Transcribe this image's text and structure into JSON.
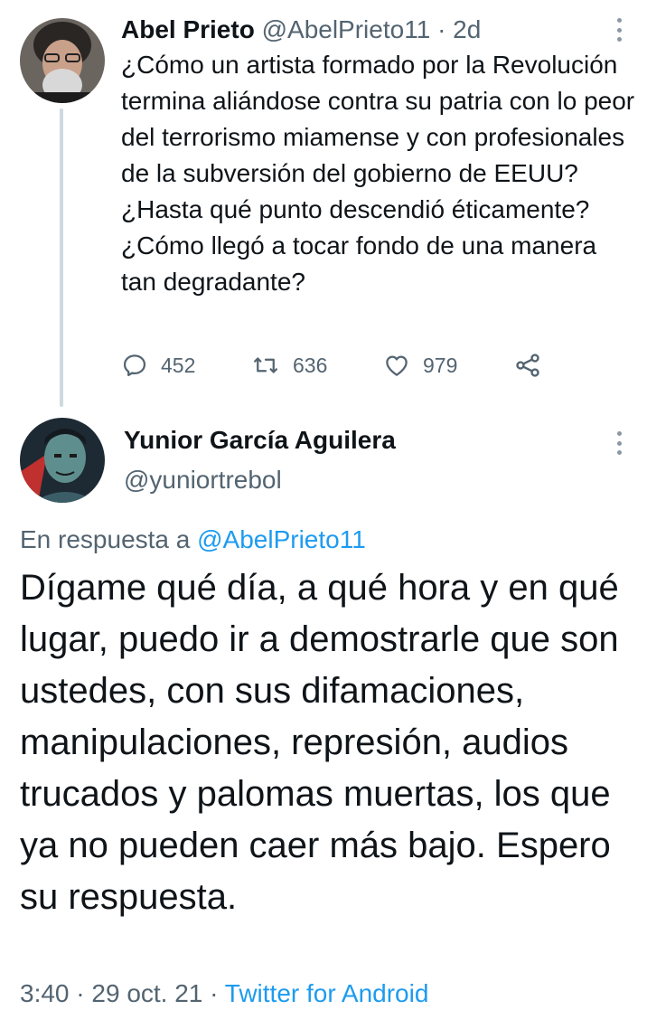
{
  "parent_tweet": {
    "author_name": "Abel Prieto",
    "handle": "@AbelPrieto11",
    "separator": "·",
    "time_ago": "2d",
    "text": "¿Cómo un artista formado por la Revolución termina aliándose contra su patria con lo peor del terrorismo miamense y con profesionales de la subversión del gobierno de EEUU? ¿Hasta qué punto descendió éticamente? ¿Cómo llegó a tocar fondo de una manera tan degradante?",
    "reply_count": "452",
    "retweet_count": "636",
    "like_count": "979",
    "icons": [
      "reply-icon",
      "retweet-icon",
      "like-icon",
      "share-icon",
      "more-options-icon"
    ]
  },
  "main_tweet": {
    "author_name": "Yunior García Aguilera",
    "handle": "@yuniortrebol",
    "reply_prefix": "En respuesta a ",
    "reply_to_handle": "@AbelPrieto11",
    "text": "Dígame qué día, a qué hora y en qué lugar, puedo ir a demostrarle que son ustedes, con sus difamaciones, manipulaciones, represión, audios trucados y palomas muertas, los que ya no pueden caer más bajo. Espero su respuesta.",
    "time": "3:40",
    "date": "29 oct. 21",
    "source": "Twitter for Android"
  },
  "colors": {
    "text": "#0f1419",
    "muted": "#536471",
    "link": "#1d9bf0",
    "thread_line": "#cfd9de"
  }
}
